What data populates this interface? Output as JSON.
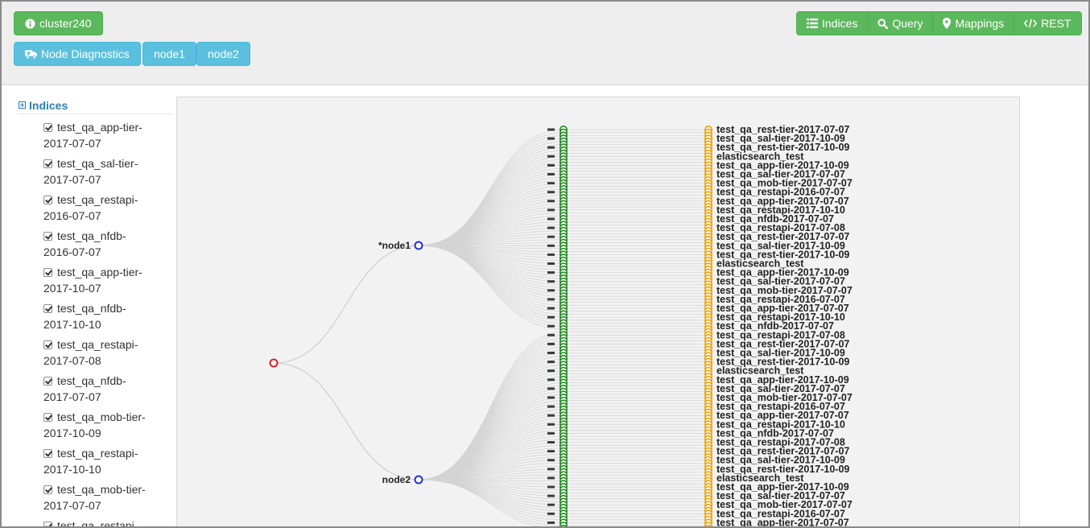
{
  "header": {
    "cluster_label": "cluster240",
    "node_diagnostics_label": "Node Diagnostics",
    "nodes": [
      "node1",
      "node2"
    ]
  },
  "nav": {
    "indices_label": "Indices",
    "query_label": "Query",
    "mappings_label": "Mappings",
    "rest_label": "REST"
  },
  "sidebar": {
    "title": "Indices",
    "items": [
      {
        "line1": "test_qa_app-tier-",
        "line2": "2017-07-07",
        "checked": true
      },
      {
        "line1": "test_qa_sal-tier-",
        "line2": "2017-07-07",
        "checked": true
      },
      {
        "line1": "test_qa_restapi-",
        "line2": "2016-07-07",
        "checked": true
      },
      {
        "line1": "test_qa_nfdb-",
        "line2": "2016-07-07",
        "checked": true
      },
      {
        "line1": "test_qa_app-tier-",
        "line2": "2017-10-07",
        "checked": true
      },
      {
        "line1": "test_qa_nfdb-",
        "line2": "2017-10-10",
        "checked": true
      },
      {
        "line1": "test_qa_restapi-",
        "line2": "2017-07-08",
        "checked": true
      },
      {
        "line1": "test_qa_nfdb-",
        "line2": "2017-07-07",
        "checked": true
      },
      {
        "line1": "test_qa_mob-tier-",
        "line2": "2017-10-09",
        "checked": true
      },
      {
        "line1": "test_qa_restapi-",
        "line2": "2017-10-10",
        "checked": true
      },
      {
        "line1": "test_qa_mob-tier-",
        "line2": "2017-07-07",
        "checked": true
      },
      {
        "line1": "test_qa_restapi-",
        "line2": "",
        "checked": true
      }
    ]
  },
  "graph": {
    "root_color": "#e02020",
    "node_color": "#1f2fd8",
    "shard_color": "#1e8a1e",
    "index_color": "#f0a000",
    "nodes": [
      {
        "label": "*node1"
      },
      {
        "label": "node2"
      }
    ],
    "index_labels": [
      "test_qa_rest-tier-2017-07-07",
      "test_qa_sal-tier-2017-10-09",
      "test_qa_rest-tier-2017-10-09",
      "elasticsearch_test",
      "test_qa_app-tier-2017-10-09",
      "test_qa_sal-tier-2017-07-07",
      "test_qa_mob-tier-2017-07-07",
      "test_qa_restapi-2016-07-07",
      "test_qa_app-tier-2017-07-07",
      "test_qa_restapi-2017-10-10",
      "test_qa_nfdb-2017-07-07",
      "test_qa_restapi-2017-07-08"
    ]
  }
}
